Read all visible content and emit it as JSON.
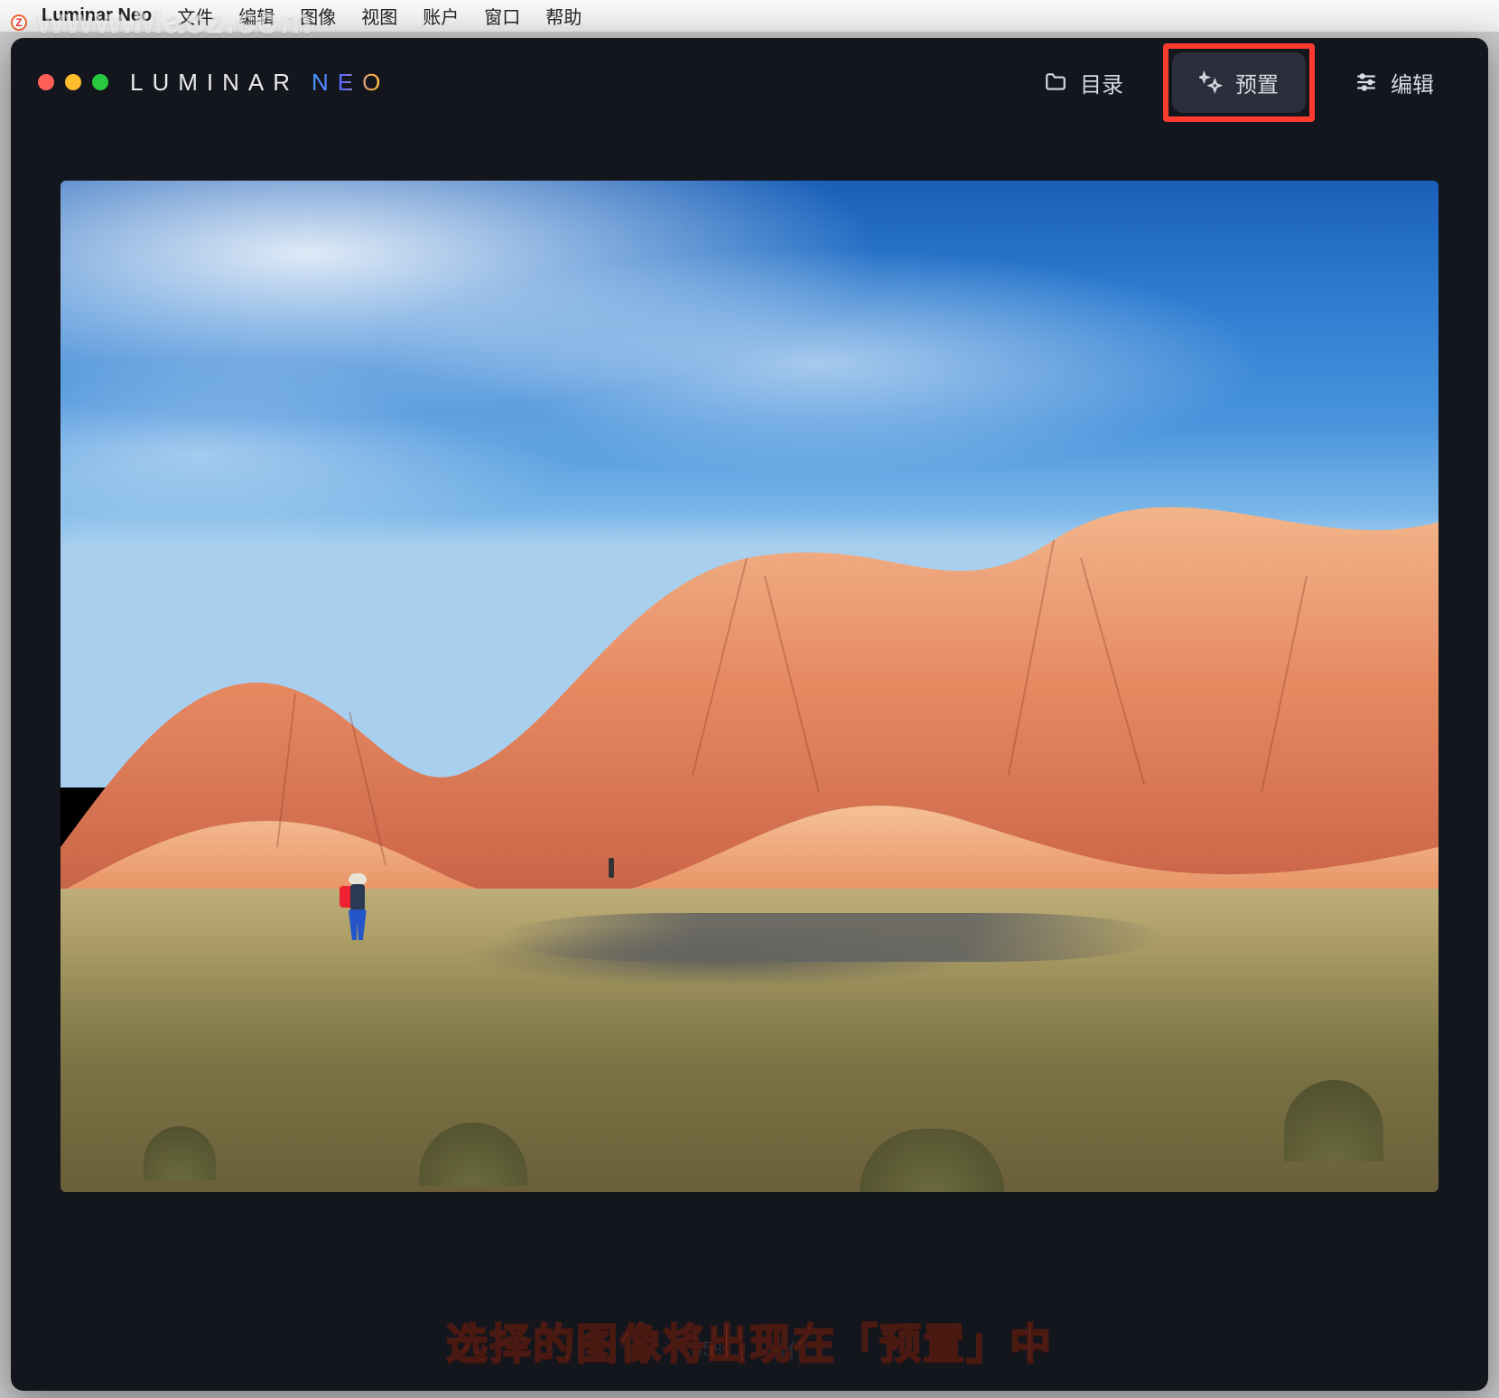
{
  "menubar": {
    "app_name": "Luminar Neo",
    "items": [
      "文件",
      "编辑",
      "图像",
      "视图",
      "账户",
      "窗口",
      "帮助"
    ]
  },
  "watermark": "www.Macz.com",
  "window": {
    "brand_word1": "LUMINAR",
    "brand_word2": "NEO",
    "tabs": {
      "catalog": "目录",
      "presets": "预置",
      "edit": "编辑"
    }
  },
  "footer": {
    "zoom_ghost": "45%",
    "action_ghost": "操作"
  },
  "caption": "选择的图像将出现在「预置」中"
}
